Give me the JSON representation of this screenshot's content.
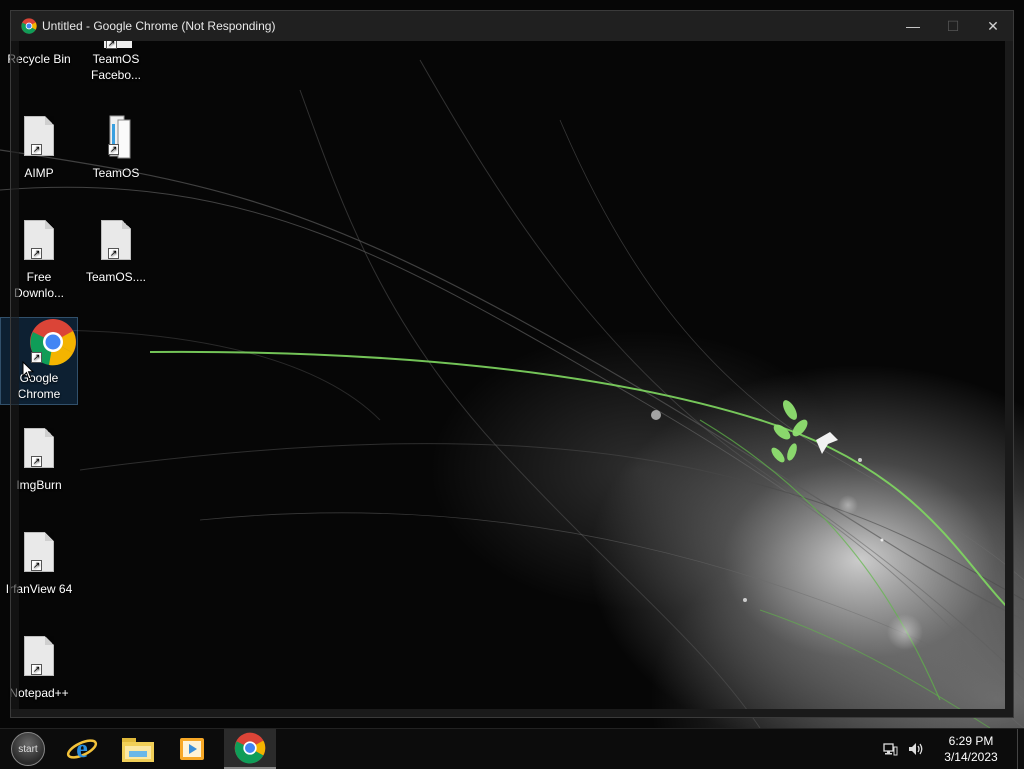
{
  "window": {
    "title": "Untitled - Google Chrome (Not Responding)",
    "controls": {
      "minimize": "—",
      "maximize": "☐",
      "close": "✕"
    }
  },
  "desktop": {
    "icons": [
      {
        "label": "Recycle Bin",
        "icon": "recycle-bin-icon"
      },
      {
        "label": "TeamOS Facebo...",
        "icon": "shortcut-file-icon"
      },
      {
        "label": "AIMP",
        "icon": "file-icon"
      },
      {
        "label": "TeamOS",
        "icon": "folder-icon"
      },
      {
        "label": "Free Downlo...",
        "icon": "file-icon"
      },
      {
        "label": "TeamOS....",
        "icon": "file-icon"
      },
      {
        "label": "Google Chrome",
        "icon": "chrome-icon"
      },
      {
        "label": "ImgBurn",
        "icon": "file-icon"
      },
      {
        "label": "IrfanView 64",
        "icon": "file-icon"
      },
      {
        "label": "Notepad++",
        "icon": "file-icon"
      }
    ]
  },
  "taskbar": {
    "start_label": "start",
    "pinned": [
      {
        "name": "Internet Explorer",
        "icon": "internet-explorer-icon"
      },
      {
        "name": "File Explorer",
        "icon": "file-explorer-icon"
      },
      {
        "name": "Media Player",
        "icon": "media-player-icon"
      },
      {
        "name": "Google Chrome",
        "icon": "chrome-icon",
        "active": true
      }
    ],
    "tray": {
      "time": "6:29 PM",
      "date": "3/14/2023",
      "icons": [
        "network-icon",
        "volume-icon"
      ]
    }
  },
  "colors": {
    "accent_green": "#6ccf4f",
    "titlebar": "#202020",
    "taskbar": "#0c0c0c"
  }
}
